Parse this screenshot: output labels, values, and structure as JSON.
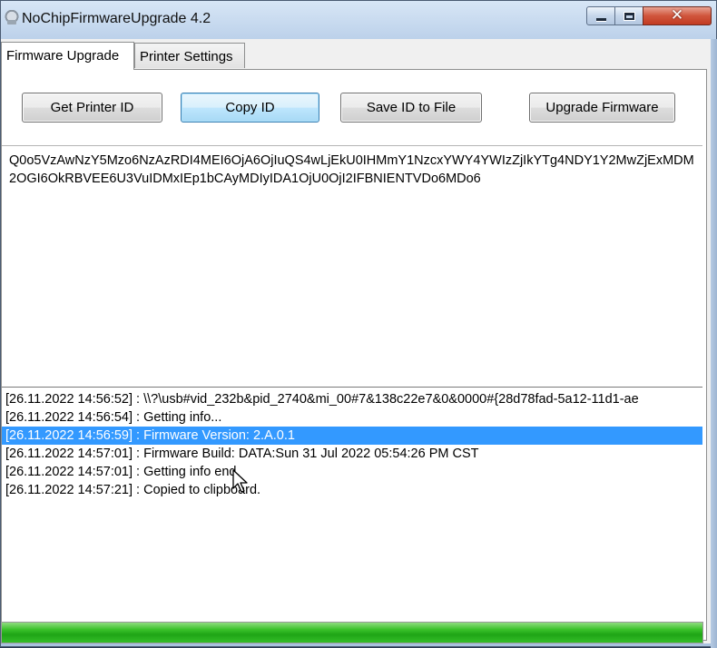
{
  "window": {
    "title": "NoChipFirmwareUpgrade 4.2",
    "close_glyph": "✕"
  },
  "tabs": [
    {
      "label": "Firmware Upgrade",
      "selected": true
    },
    {
      "label": "Printer Settings",
      "selected": false
    }
  ],
  "toolbar": {
    "get_id_label": "Get Printer ID",
    "copy_id_label": "Copy ID",
    "save_id_label": "Save ID to File",
    "upgrade_label": "Upgrade Firmware"
  },
  "printer_id_text": "Q0o5VzAwNzY5Mzo6NzAzRDI4MEI6OjA6OjIuQS4wLjEkU0IHMmY1NzcxYWY4YWIzZjIkYTg4NDY1Y2MwZjExMDM2OGI6OkRBVEE6U3VuIDMxIEp1bCAyMDIyIDA1OjU0OjI2IFBNIENTVDo6MDo6",
  "log": [
    {
      "text": "[26.11.2022 14:56:52] : \\\\?\\usb#vid_232b&pid_2740&mi_00#7&138c22e7&0&0000#{28d78fad-5a12-11d1-ae",
      "selected": false
    },
    {
      "text": "[26.11.2022 14:56:54] : Getting info...",
      "selected": false
    },
    {
      "text": "[26.11.2022 14:56:59] : Firmware Version: 2.A.0.1",
      "selected": true
    },
    {
      "text": "[26.11.2022 14:57:01] : Firmware Build: DATA:Sun 31 Jul 2022 05:54:26 PM CST",
      "selected": false
    },
    {
      "text": "[26.11.2022 14:57:01] : Getting info end.",
      "selected": false
    },
    {
      "text": "[26.11.2022 14:57:21] : Copied to clipboard.",
      "selected": false
    }
  ],
  "progress": {
    "value_percent": 100,
    "color": "#22b01a"
  },
  "colors": {
    "selection": "#3399ff",
    "accent": "#3c7fb1"
  },
  "icons": {
    "app": "printer-chip-icon",
    "minimize": "minimize-icon",
    "maximize": "maximize-icon",
    "close": "close-icon",
    "cursor": "mouse-pointer-icon"
  }
}
